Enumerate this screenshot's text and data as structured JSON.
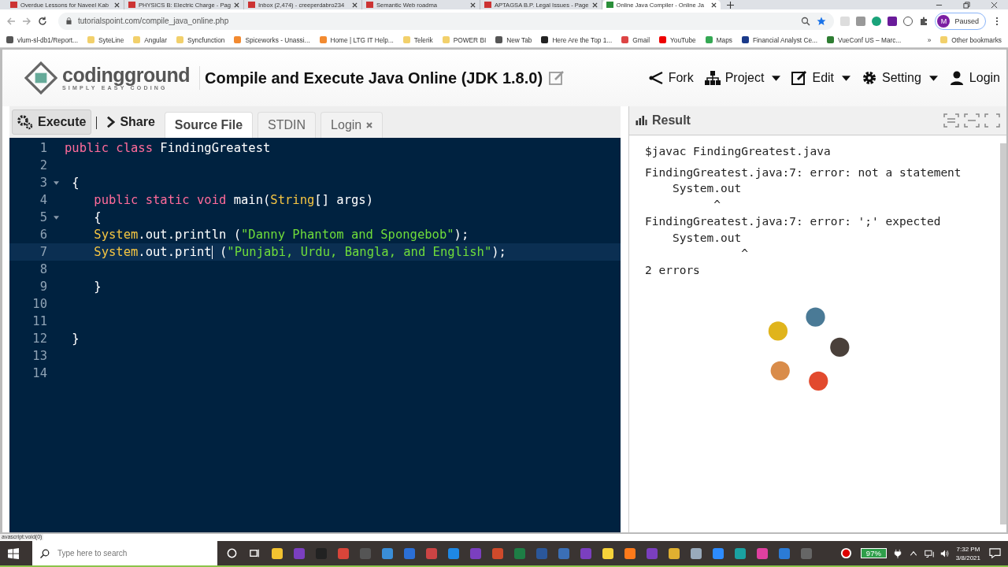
{
  "browser": {
    "tabs": [
      {
        "title": "Overdue Lessons for Naveel Kab",
        "selected": false
      },
      {
        "title": "PHYSICS B: Electric Charge - Pag",
        "selected": false
      },
      {
        "title": "Inbox (2,474) - creeperdabro234",
        "selected": false
      },
      {
        "title": "Semantic Web roadma",
        "selected": false
      },
      {
        "title": "APTAGSA B.P. Legal Issues - Page",
        "selected": false
      },
      {
        "title": "Online Java Compiler - Online Ja",
        "selected": true
      }
    ],
    "address": "tutorialspoint.com/compile_java_online.php",
    "profile": {
      "initial": "M",
      "status": "Paused"
    },
    "bookmarks": [
      "vlum-sl-db1/Report...",
      "SyteLine",
      "Angular",
      "Syncfunction",
      "Spiceworks - Unassi...",
      "Home | LTG IT Help...",
      "Telerik",
      "POWER BI",
      "New Tab",
      "Here Are the Top 1...",
      "Gmail",
      "YouTube",
      "Maps",
      "Financial Analyst Ce...",
      "VueConf US – Marc..."
    ],
    "more_bookmarks": "»",
    "other_bookmarks": "Other bookmarks"
  },
  "header": {
    "logo_name": "codingground",
    "logo_tagline": "SIMPLY EASY CODING",
    "title": "Compile and Execute Java Online (JDK 1.8.0)",
    "nav": [
      "Fork",
      "Project",
      "Edit",
      "Setting",
      "Login"
    ]
  },
  "toolbar": {
    "execute": "Execute",
    "share": "Share",
    "tabs": [
      {
        "label": "Source File",
        "selected": true,
        "closable": false
      },
      {
        "label": "STDIN",
        "selected": false,
        "closable": false
      },
      {
        "label": "Login",
        "selected": false,
        "closable": true
      }
    ]
  },
  "editor": {
    "lines": [
      {
        "number": "1",
        "active": false,
        "fold": false,
        "tokens": [
          {
            "kind": "keyword",
            "text": "public class "
          },
          {
            "kind": "plain",
            "text": "FindingGreatest"
          }
        ]
      },
      {
        "number": "2",
        "active": false,
        "fold": false
      },
      {
        "number": "3",
        "active": false,
        "fold": true,
        "tokens": [
          {
            "kind": "plain",
            "text": " {"
          }
        ]
      },
      {
        "number": "4",
        "active": false,
        "fold": false,
        "tokens": [
          {
            "kind": "keyword",
            "text": "    public static void "
          },
          {
            "kind": "plain",
            "text": "main("
          },
          {
            "kind": "type",
            "text": "String"
          },
          {
            "kind": "plain",
            "text": "[] args)"
          }
        ]
      },
      {
        "number": "5",
        "active": false,
        "fold": true,
        "tokens": [
          {
            "kind": "plain",
            "text": "    {"
          }
        ]
      },
      {
        "number": "6",
        "active": false,
        "fold": false,
        "tokens": [
          {
            "kind": "type",
            "text": "    System"
          },
          {
            "kind": "plain",
            "text": ".out.println ("
          },
          {
            "kind": "string",
            "text": "\"Danny Phantom and Spongebob\""
          },
          {
            "kind": "plain",
            "text": ");"
          }
        ]
      },
      {
        "number": "7",
        "active": true,
        "fold": false,
        "tokens": [
          {
            "kind": "type",
            "text": "    System"
          },
          {
            "kind": "plain",
            "text": ".out.print",
            "cursor_after": true
          },
          {
            "kind": "plain",
            "text": " ("
          },
          {
            "kind": "string",
            "text": "\"Punjabi, Urdu, Bangla, and English\""
          },
          {
            "kind": "plain",
            "text": ");"
          }
        ]
      },
      {
        "number": "8",
        "active": false,
        "fold": false
      },
      {
        "number": "9",
        "active": false,
        "fold": false,
        "tokens": [
          {
            "kind": "plain",
            "text": "    }"
          }
        ]
      },
      {
        "number": "10",
        "active": false,
        "fold": false
      },
      {
        "number": "11",
        "active": false,
        "fold": false
      },
      {
        "number": "12",
        "active": false,
        "fold": false,
        "tokens": [
          {
            "kind": "plain",
            "text": " }"
          }
        ]
      },
      {
        "number": "13",
        "active": false,
        "fold": false
      },
      {
        "number": "14",
        "active": false,
        "fold": false
      }
    ]
  },
  "result": {
    "title": "Result",
    "output": [
      "$javac FindingGreatest.java",
      "FindingGreatest.java:7: error: not a statement",
      "    System.out",
      "          ^",
      "FindingGreatest.java:7: error: ';' expected",
      "    System.out",
      "              ^",
      "2 errors"
    ]
  },
  "status_url": "avascript:void(0)",
  "taskbar": {
    "search_placeholder": "Type here to search",
    "battery": "97%",
    "time": "7:32 PM",
    "date": "3/8/2021"
  }
}
